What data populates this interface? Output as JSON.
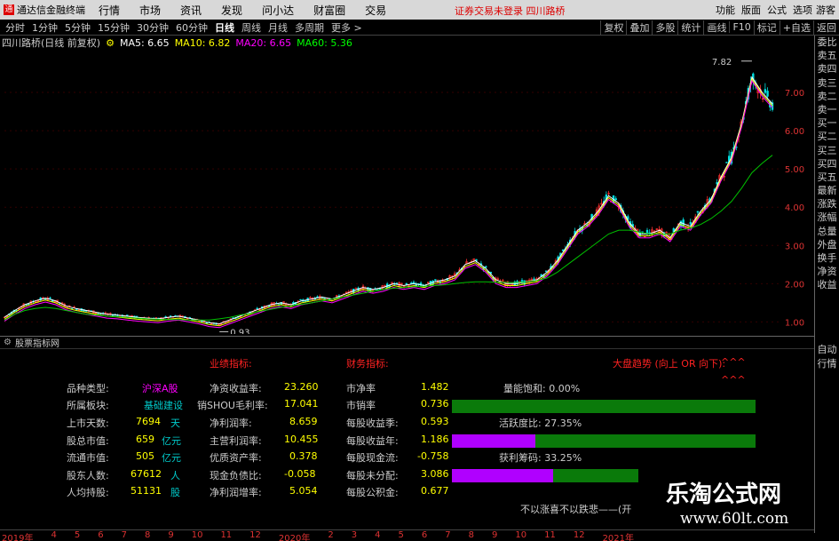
{
  "app": {
    "title": "通达信金融终端",
    "menu": [
      "行情",
      "市场",
      "资讯",
      "发现",
      "问小达",
      "财富圈",
      "交易"
    ],
    "notice": "证券交易未登录 四川路桥",
    "right_items": [
      "功能",
      "版面",
      "公式",
      "选项"
    ],
    "guest": "游客"
  },
  "periods": [
    "分时",
    "1分钟",
    "5分钟",
    "15分钟",
    "30分钟",
    "60分钟",
    "日线",
    "周线",
    "月线",
    "多周期",
    "更多 >"
  ],
  "active_period": "日线",
  "tool_buttons": [
    "复权",
    "叠加",
    "多股",
    "统计",
    "画线",
    "F10",
    "标记",
    "+自选",
    "返回"
  ],
  "info": {
    "stock": "四川路桥(日线 前复权)",
    "ma": [
      {
        "label": "MA5: 6.65",
        "color": "#ffffff"
      },
      {
        "label": "MA10: 6.82",
        "color": "#ffff00"
      },
      {
        "label": "MA20: 6.65",
        "color": "#ff00ff"
      },
      {
        "label": "MA60: 5.36",
        "color": "#00ff00"
      }
    ]
  },
  "chart_data": {
    "type": "candlestick",
    "ylim": [
      0.8,
      8.0
    ],
    "yticks": [
      "7.00",
      "6.00",
      "5.00",
      "4.00",
      "3.00",
      "2.00",
      "1.00"
    ],
    "high_label": "7.82",
    "low_label": "0.93",
    "price_path": [
      1.12,
      1.3,
      1.45,
      1.55,
      1.62,
      1.55,
      1.42,
      1.35,
      1.3,
      1.25,
      1.2,
      1.18,
      1.15,
      1.12,
      1.1,
      1.08,
      1.12,
      1.15,
      1.1,
      1.05,
      0.98,
      0.95,
      1.05,
      1.15,
      1.25,
      1.35,
      1.45,
      1.5,
      1.45,
      1.55,
      1.6,
      1.65,
      1.6,
      1.7,
      1.8,
      1.9,
      1.85,
      1.9,
      2.0,
      1.95,
      2.0,
      1.95,
      2.05,
      2.1,
      2.2,
      2.5,
      2.6,
      2.4,
      2.1,
      2.0,
      2.0,
      2.05,
      2.1,
      2.3,
      2.6,
      3.0,
      3.4,
      3.6,
      3.9,
      4.3,
      4.1,
      3.6,
      3.3,
      3.3,
      3.4,
      3.2,
      3.6,
      3.5,
      3.9,
      4.2,
      4.8,
      5.3,
      6.2,
      7.4,
      7.0,
      6.7
    ],
    "ma60_path": [
      1.05,
      1.2,
      1.3,
      1.35,
      1.38,
      1.35,
      1.3,
      1.25,
      1.2,
      1.18,
      1.15,
      1.14,
      1.12,
      1.1,
      1.08,
      1.07,
      1.06,
      1.06,
      1.05,
      1.05,
      1.05,
      1.08,
      1.12,
      1.18,
      1.22,
      1.28,
      1.33,
      1.38,
      1.42,
      1.46,
      1.5,
      1.55,
      1.6,
      1.65,
      1.7,
      1.75,
      1.8,
      1.85,
      1.88,
      1.9,
      1.92,
      1.93,
      1.95,
      1.97,
      2.0,
      2.03,
      2.05,
      2.05,
      2.04,
      2.03,
      2.03,
      2.05,
      2.08,
      2.15,
      2.3,
      2.5,
      2.7,
      2.9,
      3.1,
      3.3,
      3.4,
      3.4,
      3.35,
      3.3,
      3.3,
      3.3,
      3.4,
      3.45,
      3.55,
      3.7,
      3.9,
      4.15,
      4.5,
      4.9,
      5.15,
      5.36
    ]
  },
  "side_menu": [
    "委比",
    "卖五",
    "卖四",
    "卖三",
    "卖二",
    "卖一",
    "买一",
    "买二",
    "买三",
    "买四",
    "买五",
    "最新",
    "涨跌",
    "涨幅",
    "总量",
    "外盘",
    "换手",
    "净资",
    "收益"
  ],
  "side_menu2": [
    "自动",
    "行情"
  ],
  "panel": {
    "title": "股票指标网",
    "basic": [
      {
        "k": "品种类型:",
        "v": "沪深A股",
        "vc": "mag"
      },
      {
        "k": "所属板块:",
        "v": "基础建设",
        "vc": "cya"
      },
      {
        "k": "上市天数:",
        "v": "7694",
        "u": "天"
      },
      {
        "k": "股总市值:",
        "v": "659",
        "u": "亿元"
      },
      {
        "k": "流通市值:",
        "v": "505",
        "u": "亿元"
      },
      {
        "k": "股东人数:",
        "v": "67612",
        "u": "人"
      },
      {
        "k": "人均持股:",
        "v": "51131",
        "u": "股"
      }
    ],
    "perf_title": "业绩指标:",
    "perf": [
      {
        "k": "净资收益率:",
        "v": "23.260"
      },
      {
        "k": "销SHOU毛利率:",
        "v": "17.041"
      },
      {
        "k": "净利润率:",
        "v": "8.659"
      },
      {
        "k": "主营利润率:",
        "v": "10.455"
      },
      {
        "k": "优质资产率:",
        "v": "0.378"
      },
      {
        "k": "现金负债比:",
        "v": "-0.058"
      },
      {
        "k": "净利润增率:",
        "v": "5.054"
      }
    ],
    "fin_title": "财务指标:",
    "fin": [
      {
        "k": "市净率",
        "v": "1.482"
      },
      {
        "k": "市销率",
        "v": "0.736"
      },
      {
        "k": "每股收益季:",
        "v": "0.593"
      },
      {
        "k": "每股收益年:",
        "v": "1.186"
      },
      {
        "k": "每股现金流:",
        "v": "-0.758"
      },
      {
        "k": "每股未分配:",
        "v": "3.086"
      },
      {
        "k": "每股公积金:",
        "v": "0.677"
      }
    ],
    "trend_title": "大盘趋势 (向上 OR 向下):",
    "trend_arrows": "^^^",
    "trend_arrows2": "^^^",
    "gauges": [
      {
        "label": "量能饱和: 0.00%",
        "fill": 0.0
      },
      {
        "label": "活跃度比: 27.35%",
        "fill": 0.2735
      },
      {
        "label": "获利筹码: 33.25%",
        "fill": 0.3325
      }
    ],
    "slogan": "不以涨喜不以跌悲——(开"
  },
  "bottom_axis": [
    "2019年",
    "4",
    "5",
    "6",
    "7",
    "8",
    "9",
    "10",
    "11",
    "12",
    "2020年",
    "2",
    "3",
    "4",
    "5",
    "6",
    "7",
    "8",
    "9",
    "10",
    "11",
    "12",
    "2021年"
  ],
  "watermark": {
    "title": "乐淘公式网",
    "url": "www.60lt.com"
  }
}
